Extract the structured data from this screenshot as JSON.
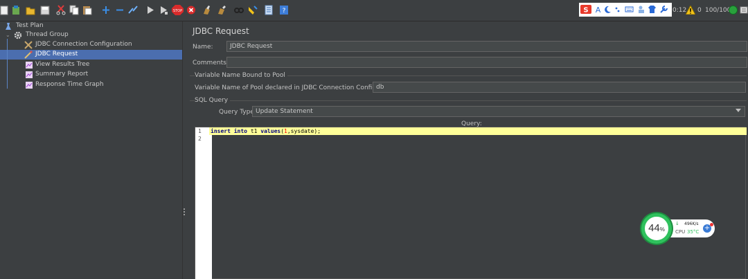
{
  "toolbar": {
    "icons": [
      "new-icon",
      "templates-icon",
      "open-icon",
      "save-icon",
      "cut-icon",
      "copy-icon",
      "paste-icon",
      "expand-icon",
      "collapse-icon",
      "toggle-icon",
      "start-icon",
      "start-no-pause-icon",
      "stop-icon",
      "shutdown-icon",
      "clear-icon",
      "clear-all-icon",
      "search-icon",
      "reset-search-icon",
      "function-helper-icon",
      "help-icon"
    ],
    "time_fragment": "0:12",
    "error_count": "0",
    "threads": "100/100"
  },
  "tree": {
    "items": [
      {
        "label": "Test Plan",
        "icon": "test-plan-icon"
      },
      {
        "label": "Thread Group",
        "icon": "gear-icon"
      },
      {
        "label": "JDBC Connection Configuration",
        "icon": "config-element-icon"
      },
      {
        "label": "JDBC Request",
        "icon": "sampler-icon",
        "selected": true
      },
      {
        "label": "View Results Tree",
        "icon": "listener-icon"
      },
      {
        "label": "Summary Report",
        "icon": "listener-icon"
      },
      {
        "label": "Response Time Graph",
        "icon": "listener-icon"
      }
    ]
  },
  "panel": {
    "title": "JDBC Request",
    "name_label": "Name:",
    "name_value": "JDBC Request",
    "comments_label": "Comments:",
    "comments_value": "",
    "pool_section": "Variable Name Bound to Pool",
    "pool_label": "Variable Name of Pool declared in JDBC Connection Configuration:",
    "pool_value": "db",
    "sql_section": "SQL Query",
    "query_type_label": "Query Type:",
    "query_type_value": "Update Statement",
    "query_label": "Query:"
  },
  "editor": {
    "line_numbers": [
      "1",
      "2"
    ],
    "code": {
      "kw1": "insert",
      "kw2": "into",
      "t1": "t1",
      "kw3": "values",
      "open": "(",
      "num": "1",
      "rest": ",sysdate);"
    }
  },
  "monitor": {
    "cpu_percent": "44",
    "percent_sign": "%",
    "net_speed": "496K/s",
    "arrow": "↓",
    "cpu_label": "CPU",
    "cpu_temp": "35°C"
  },
  "colors": {
    "selection": "#4b6eaf",
    "editor_line_highlight": "#ffff99",
    "monitor_green": "#2fc15d"
  }
}
